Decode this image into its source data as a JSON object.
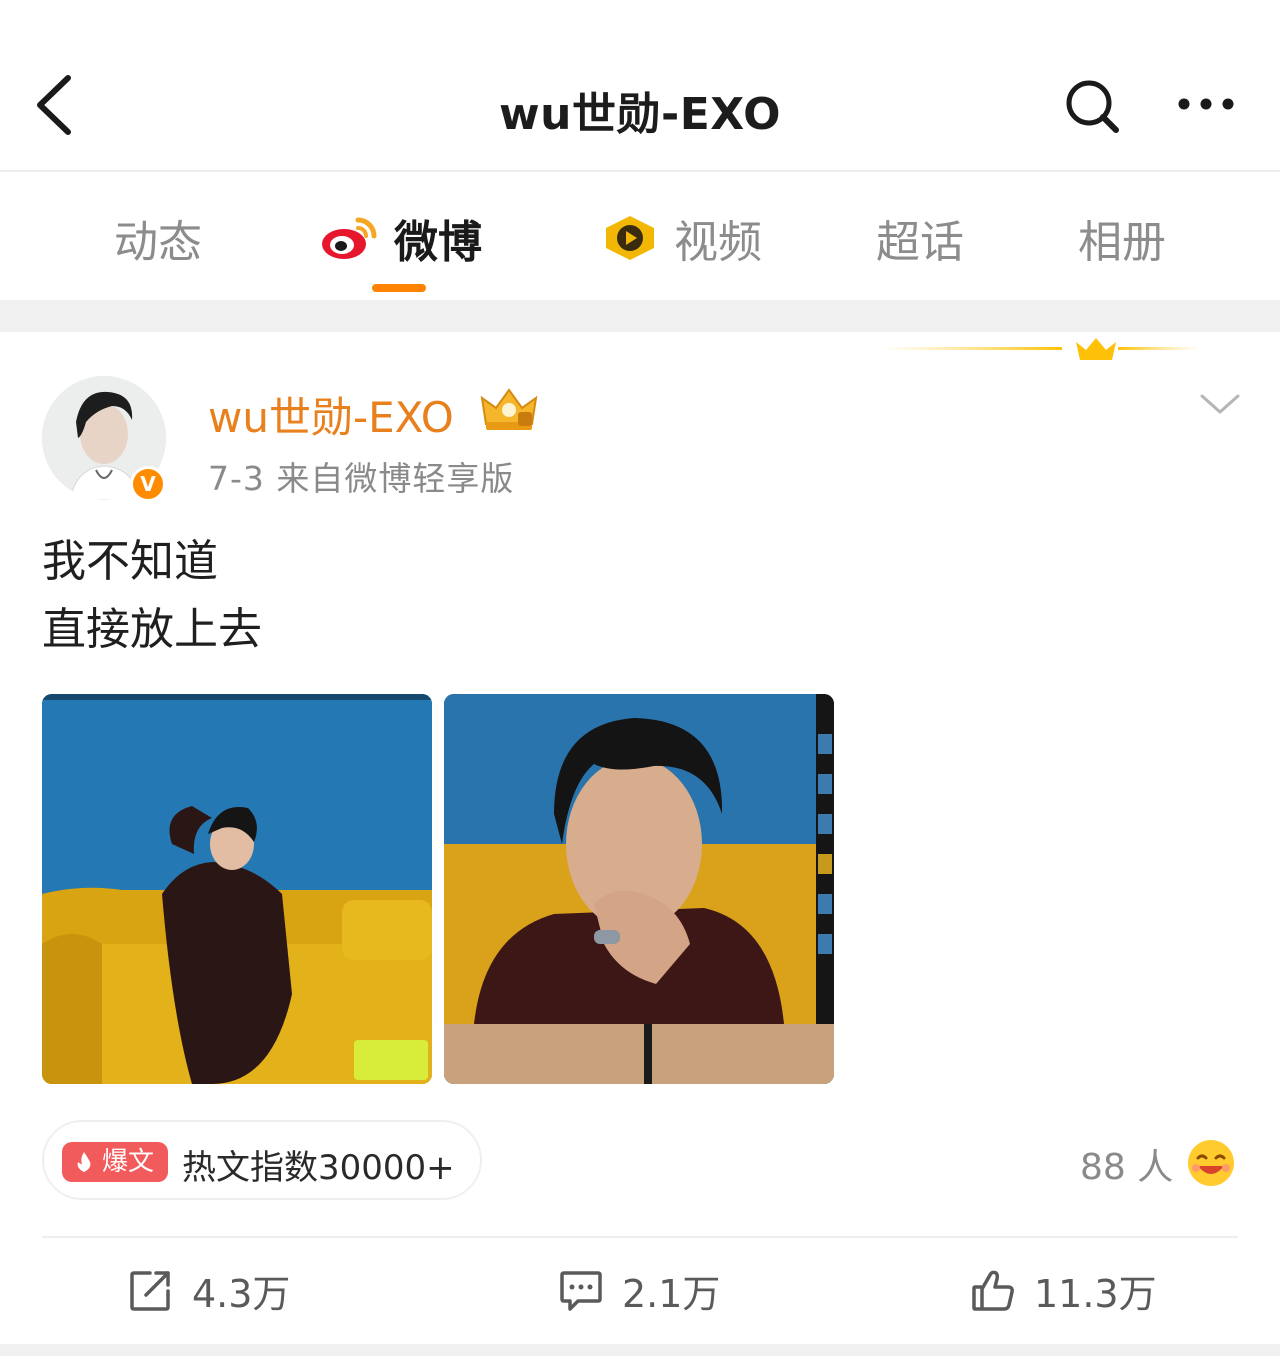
{
  "header": {
    "title": "wu世勋-EXO",
    "back_icon": "chevron-left-icon",
    "search_icon": "search-icon",
    "more_icon": "more-horizontal-icon"
  },
  "tabs": [
    {
      "label": "动态",
      "active": false
    },
    {
      "label": "微博",
      "active": true,
      "icon": "weibo-logo-icon"
    },
    {
      "label": "视频",
      "active": false,
      "icon": "video-play-badge-icon"
    },
    {
      "label": "超话",
      "active": false
    },
    {
      "label": "相册",
      "active": false
    }
  ],
  "post": {
    "author": "wu世勋-EXO",
    "verified_mark": "V",
    "meta": "7-3  来自微博轻享版",
    "text_lines": [
      "我不知道",
      "直接放上去"
    ],
    "images": [
      {
        "desc": "man seated on yellow sofa against blue wall"
      },
      {
        "desc": "close-up portrait on monitor screen"
      }
    ],
    "hot_badge": {
      "pill": "爆文",
      "label": "热文指数30000+"
    },
    "reactors": "88 人",
    "actions": {
      "repost": "4.3万",
      "comment": "2.1万",
      "like": "11.3万"
    }
  },
  "colors": {
    "accent": "#ff8200",
    "author": "#e8801e",
    "hot_pill": "#f25b5b",
    "verify": "#ff8c00"
  }
}
